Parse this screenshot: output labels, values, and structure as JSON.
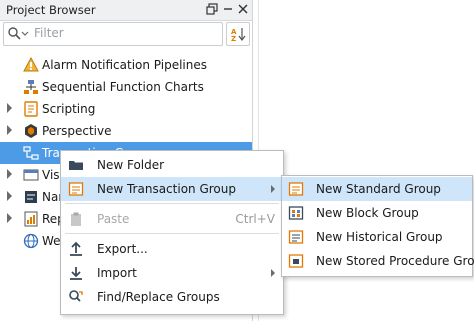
{
  "panel": {
    "title": "Project Browser",
    "search": {
      "placeholder": "Filter",
      "value": ""
    }
  },
  "tree": {
    "items": [
      {
        "label": "Alarm Notification Pipelines",
        "icon": "alarm-pipeline-icon",
        "expandable": false
      },
      {
        "label": "Sequential Function Charts",
        "icon": "sfc-icon",
        "expandable": false
      },
      {
        "label": "Scripting",
        "icon": "scripting-icon",
        "expandable": true
      },
      {
        "label": "Perspective",
        "icon": "perspective-icon",
        "expandable": true
      },
      {
        "label": "Transaction Groups",
        "icon": "transaction-groups-icon",
        "expandable": false,
        "selected": true
      },
      {
        "label": "Visi",
        "icon": "vision-icon",
        "expandable": true
      },
      {
        "label": "Nar",
        "icon": "named-query-icon",
        "expandable": true
      },
      {
        "label": "Rep",
        "icon": "reports-icon",
        "expandable": true
      },
      {
        "label": "Wel",
        "icon": "web-dev-icon",
        "expandable": false
      }
    ]
  },
  "context_menu": {
    "items": [
      {
        "label": "New Folder",
        "icon": "folder-icon"
      },
      {
        "label": "New Transaction Group",
        "icon": "transaction-group-icon",
        "submenu": true,
        "highlighted": true
      },
      {
        "label": "Paste",
        "icon": "paste-icon",
        "shortcut": "Ctrl+V",
        "disabled": true
      },
      {
        "label": "Export...",
        "icon": "export-icon"
      },
      {
        "label": "Import",
        "icon": "import-icon",
        "submenu": true
      },
      {
        "label": "Find/Replace Groups",
        "icon": "find-replace-icon"
      }
    ]
  },
  "submenu": {
    "items": [
      {
        "label": "New Standard Group",
        "icon": "standard-group-icon",
        "highlighted": true
      },
      {
        "label": "New Block Group",
        "icon": "block-group-icon"
      },
      {
        "label": "New Historical Group",
        "icon": "historical-group-icon"
      },
      {
        "label": "New Stored Procedure Group",
        "icon": "stored-procedure-group-icon"
      }
    ]
  },
  "colors": {
    "selection": "#4d9be6",
    "hover": "#cfe5f9",
    "accent": "#e07b00"
  }
}
